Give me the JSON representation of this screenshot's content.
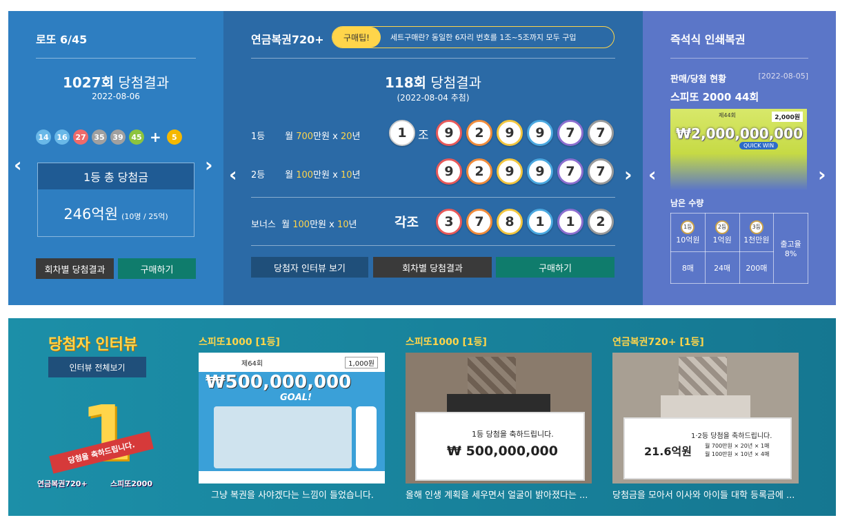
{
  "lotto": {
    "title": "로또 6/45",
    "round": "1027회",
    "round_suffix": "당첨결과",
    "date": "2022-08-06",
    "balls": [
      {
        "n": "14",
        "color": "#69b8e8"
      },
      {
        "n": "16",
        "color": "#69b8e8"
      },
      {
        "n": "27",
        "color": "#ef6a6a"
      },
      {
        "n": "35",
        "color": "#a0a0a0"
      },
      {
        "n": "39",
        "color": "#a0a0a0"
      },
      {
        "n": "45",
        "color": "#8cc43e"
      }
    ],
    "plus": "+",
    "bonus": {
      "n": "5",
      "color": "#f5b800"
    },
    "total_label": "1등 총 당첨금",
    "total_amount": "246억원",
    "total_detail": "(10명 / 25억)",
    "btn_history": "회차별 당첨결과",
    "btn_buy": "구매하기"
  },
  "pension": {
    "title": "연금복권720+",
    "tip_badge": "구매팁!",
    "tip_text": "세트구매란? 동일한 6자리 번호를 1조~5조까지 모두 구입",
    "round": "118회",
    "round_suffix": "당첨결과",
    "date": "(2022-08-04 추첨)",
    "rows": [
      {
        "rank": "1등",
        "pre": "월 ",
        "amount": "700",
        "mid": "만원 x ",
        "years": "20",
        "post": "년"
      },
      {
        "rank": "2등",
        "pre": "월 ",
        "amount": "100",
        "mid": "만원 x ",
        "years": "10",
        "post": "년"
      },
      {
        "rank": "보너스",
        "pre": "월 ",
        "amount": "100",
        "mid": "만원 x ",
        "years": "10",
        "post": "년"
      }
    ],
    "group_num": "1",
    "group_unit": "조",
    "each_label": "각조",
    "first_numbers": [
      "9",
      "2",
      "9",
      "9",
      "7",
      "7"
    ],
    "second_numbers": [
      "9",
      "2",
      "9",
      "9",
      "7",
      "7"
    ],
    "bonus_numbers": [
      "3",
      "7",
      "8",
      "1",
      "1",
      "2"
    ],
    "ring_colors": [
      "#e85a5a",
      "#f08c3c",
      "#f2c640",
      "#4aa8e0",
      "#8c6fd0",
      "#9a9a9a"
    ],
    "btn_interview": "당첨자 인터뷰 보기",
    "btn_history": "회차별 당첨결과",
    "btn_buy": "구매하기"
  },
  "instant": {
    "title": "즉석식 인쇄복권",
    "status_label": "판매/당첨 현황",
    "status_date": "[2022-08-05]",
    "game_name": "스피또 2000 44회",
    "ticket_amount": "₩2,000,000,000",
    "ticket_price": "2,000원",
    "ticket_round": "제44회",
    "remaining_label": "남은 수량",
    "ranks": [
      {
        "medal": "1등",
        "prize": "10억원",
        "count": "8매"
      },
      {
        "medal": "2등",
        "prize": "1억원",
        "count": "24매"
      },
      {
        "medal": "3등",
        "prize": "1천만원",
        "count": "200매"
      }
    ],
    "rate_label": "출고율",
    "rate_value": "8%"
  },
  "interview": {
    "title": "당첨자 인터뷰",
    "view_all": "인터뷰 전체보기",
    "banner_text": "당첨을 축하드립니다.",
    "logo1": "연금복권720+",
    "logo2": "스피또2000",
    "cards": [
      {
        "title": "스피또1000 [1등]",
        "caption": "그냥 복권을 사야겠다는 느낌이 들었습니다.",
        "img_amount": "₩500,000,000",
        "img_goal": "GOAL!",
        "img_round": "제64회",
        "img_price": "1,000원"
      },
      {
        "title": "스피또1000 [1등]",
        "caption": "올해 인생 계획을 세우면서 얼굴이 밝아졌다는 ...",
        "board_title": "1등 당첨을 축하드립니다.",
        "board_amount": "₩ 500,000,000"
      },
      {
        "title": "연금복권720+ [1등]",
        "caption": "당첨금을 모아서 이사와 아이들 대학 등록금에 ...",
        "board_title": "1·2등 당첨을 축하드립니다.",
        "board_amount": "21.6억원",
        "board_line1": "월 700만원 × 20년 × 1매",
        "board_line2": "월 100만원 × 10년 × 4매"
      }
    ]
  },
  "arrows": {
    "left": "‹",
    "right": "›"
  },
  "colors": {
    "dark_btn": "#3a3a3a",
    "teal_btn": "#0f7c6c",
    "dark_navy": "#1f4f7a",
    "gold": "#ffd54a"
  }
}
